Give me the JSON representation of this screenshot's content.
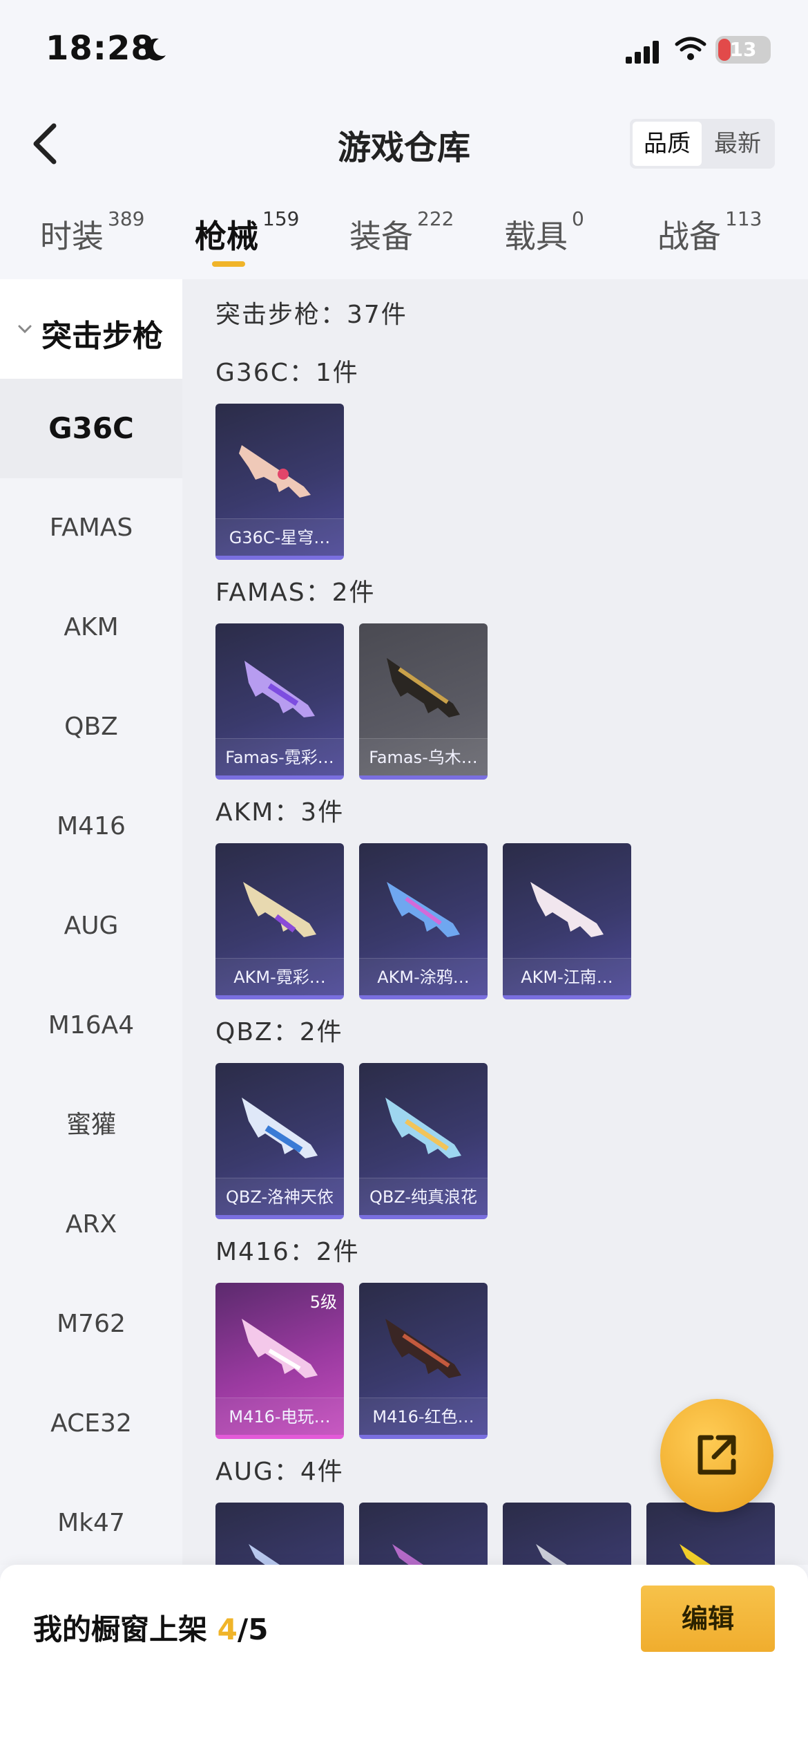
{
  "status_bar": {
    "time": "18:28",
    "battery": "13"
  },
  "header": {
    "title": "游戏仓库",
    "sort_options": [
      "品质",
      "最新"
    ],
    "sort_selected": "品质"
  },
  "tabs": [
    {
      "label": "时装",
      "count": "389"
    },
    {
      "label": "枪械",
      "count": "159",
      "active": true
    },
    {
      "label": "装备",
      "count": "222"
    },
    {
      "label": "载具",
      "count": "0"
    },
    {
      "label": "战备",
      "count": "113"
    }
  ],
  "sidebar": {
    "category": "突击步枪",
    "items": [
      "G36C",
      "FAMAS",
      "AKM",
      "QBZ",
      "M416",
      "AUG",
      "M16A4",
      "蜜獾",
      "ARX",
      "M762",
      "ACE32",
      "Mk47"
    ],
    "selected": "G36C"
  },
  "content": {
    "summary": "突击步枪：37件",
    "sections": [
      {
        "title": "G36C：1件",
        "items": [
          {
            "name": "G36C-星穹…"
          }
        ]
      },
      {
        "title": "FAMAS：2件",
        "items": [
          {
            "name": "Famas-霓彩…"
          },
          {
            "name": "Famas-乌木…"
          }
        ]
      },
      {
        "title": "AKM：3件",
        "items": [
          {
            "name": "AKM-霓彩…"
          },
          {
            "name": "AKM-涂鸦…"
          },
          {
            "name": "AKM-江南…"
          }
        ]
      },
      {
        "title": "QBZ：2件",
        "items": [
          {
            "name": "QBZ-洛神天依"
          },
          {
            "name": "QBZ-纯真浪花"
          }
        ]
      },
      {
        "title": "M416：2件",
        "items": [
          {
            "name": "M416-电玩…",
            "level": "5级"
          },
          {
            "name": "M416-红色…"
          }
        ]
      },
      {
        "title": "AUG：4件",
        "items": [
          {
            "name": ""
          },
          {
            "name": ""
          },
          {
            "name": ""
          },
          {
            "name": ""
          }
        ]
      }
    ]
  },
  "bottom_bar": {
    "label": "我的橱窗上架 ",
    "current": "4",
    "total": "/5",
    "edit_label": "编辑"
  },
  "colors": {
    "accent": "#f0b429",
    "card_purple": "#3a3a6c",
    "card_pink": "#9a3aa0"
  },
  "icons": [
    "moon-icon",
    "signal-icon",
    "wifi-icon",
    "battery-icon",
    "back-icon",
    "chevron-down-icon",
    "share-icon"
  ]
}
